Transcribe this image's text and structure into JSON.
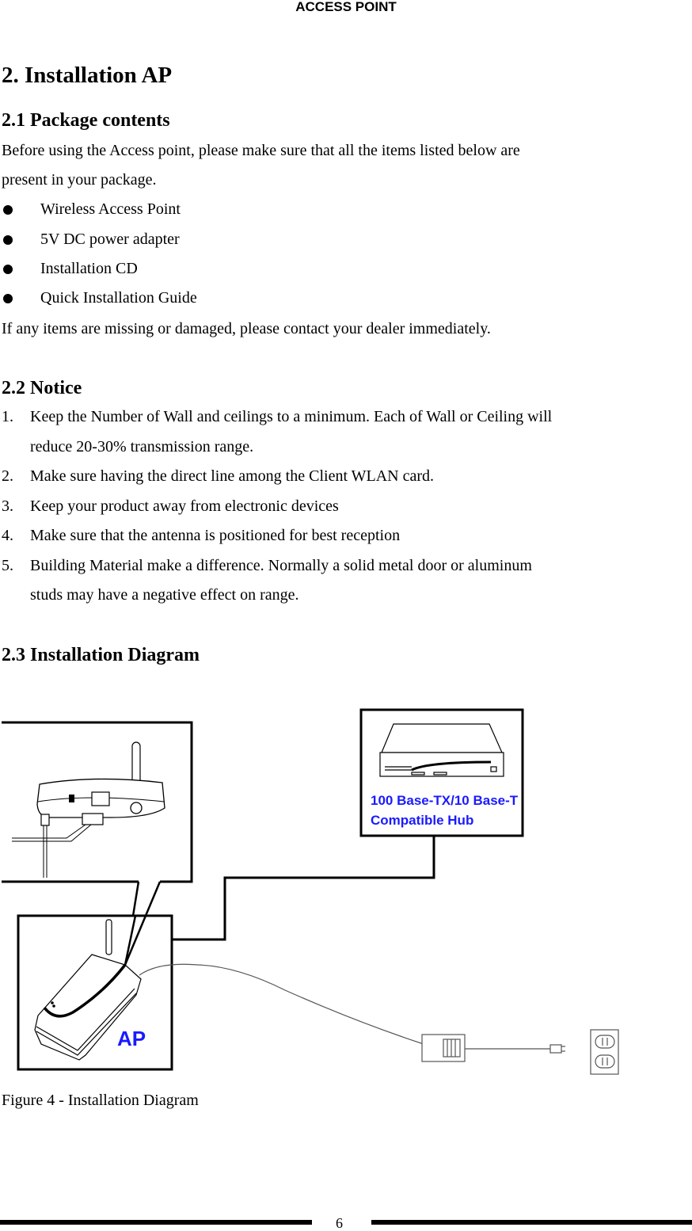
{
  "header": {
    "running_title": "ACCESS POINT"
  },
  "section": {
    "title": "2. Installation AP",
    "package": {
      "heading": "2.1 Package contents",
      "intro_line1": "Before using the Access point, please make sure that all the items listed below are",
      "intro_line2": "present in your package.",
      "items": [
        "Wireless Access Point",
        "5V DC power adapter",
        "Installation CD",
        "Quick Installation Guide"
      ],
      "outro": "If any items are missing or damaged, please contact your dealer immediately."
    },
    "notice": {
      "heading": "2.2 Notice",
      "items": [
        {
          "num": "1.",
          "lines": [
            "Keep the Number of Wall and ceilings to a minimum. Each of Wall or Ceiling will",
            "reduce 20-30% transmission range."
          ]
        },
        {
          "num": "2.",
          "lines": [
            "Make sure having the direct line among the Client WLAN card."
          ]
        },
        {
          "num": "3.",
          "lines": [
            "Keep your product away from electronic devices"
          ]
        },
        {
          "num": "4.",
          "lines": [
            "Make sure that the antenna is positioned for best reception"
          ]
        },
        {
          "num": "5.",
          "lines": [
            "Building Material make a difference. Normally a solid metal door or aluminum",
            "studs may have a negative effect on range."
          ]
        }
      ]
    },
    "diagram": {
      "heading": "2.3 Installation Diagram",
      "hub_label_line1": "100 Base-TX/10 Base-T",
      "hub_label_line2": "Compatible Hub",
      "ap_label": "AP",
      "label_color": "#1a1aff",
      "caption": "Figure 4 - Installation Diagram"
    }
  },
  "footer": {
    "page_number": "6"
  }
}
